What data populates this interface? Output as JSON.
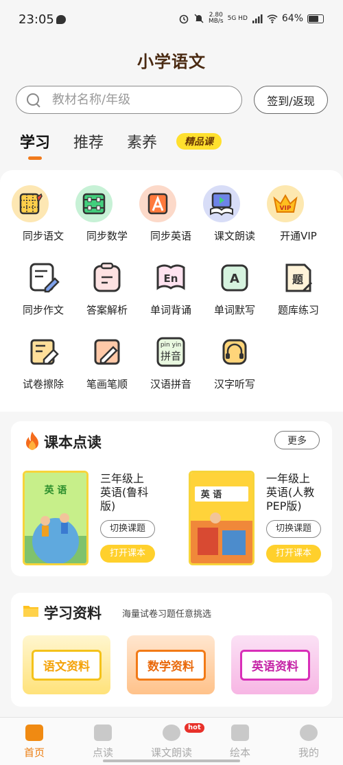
{
  "status": {
    "time": "23:05",
    "net_speed": "2.80",
    "net_unit": "MB/s",
    "signal": "5G HD",
    "battery": "64%"
  },
  "app_title": "小学语文",
  "search": {
    "placeholder": "教材名称/年级"
  },
  "signin_label": "签到/返现",
  "tabs": [
    {
      "label": "学习"
    },
    {
      "label": "推荐"
    },
    {
      "label": "素养"
    }
  ],
  "tab_badge": "精品课",
  "features": [
    {
      "label": "同步语文",
      "icon": "grid-pencil-icon"
    },
    {
      "label": "同步数学",
      "icon": "abacus-icon"
    },
    {
      "label": "同步英语",
      "icon": "letter-a-icon"
    },
    {
      "label": "课文朗读",
      "icon": "play-book-icon"
    },
    {
      "label": "开通VIP",
      "icon": "vip-crown-icon"
    },
    {
      "label": "同步作文",
      "icon": "composition-icon"
    },
    {
      "label": "答案解析",
      "icon": "clipboard-icon"
    },
    {
      "label": "单词背诵",
      "icon": "en-book-icon"
    },
    {
      "label": "单词默写",
      "icon": "letter-card-icon"
    },
    {
      "label": "题库练习",
      "icon": "question-bank-icon"
    },
    {
      "label": "试卷擦除",
      "icon": "eraser-icon"
    },
    {
      "label": "笔画笔顺",
      "icon": "stroke-pen-icon"
    },
    {
      "label": "汉语拼音",
      "icon": "pinyin-icon"
    },
    {
      "label": "汉字听写",
      "icon": "headphone-icon"
    }
  ],
  "pinyin_icon": {
    "top": "pin yin",
    "bottom": "拼音"
  },
  "read_section": {
    "title": "课本点读",
    "more": "更多",
    "books": [
      {
        "cover_title": "英 语",
        "name": "三年级上\n英语(鲁科\n版)",
        "switch": "切换课题",
        "open": "打开课本"
      },
      {
        "cover_title": "英 语",
        "name": "一年级上\n英语(人教\nPEP版)",
        "switch": "切换课题",
        "open": "打开课本"
      }
    ]
  },
  "materials": {
    "title": "学习资料",
    "subtitle": "海量试卷习题任意挑选",
    "items": [
      {
        "label": "语文资料",
        "color": "#f4c21a"
      },
      {
        "label": "数学资料",
        "color": "#f27a16"
      },
      {
        "label": "英语资料",
        "color": "#d82fb8"
      }
    ]
  },
  "nav": [
    {
      "label": "首页"
    },
    {
      "label": "点读"
    },
    {
      "label": "课文朗读"
    },
    {
      "label": "绘本"
    },
    {
      "label": "我的"
    }
  ],
  "nav_hot": "hot",
  "colors": {
    "accent": "#f07a1c",
    "yellow": "#ffd02c"
  }
}
